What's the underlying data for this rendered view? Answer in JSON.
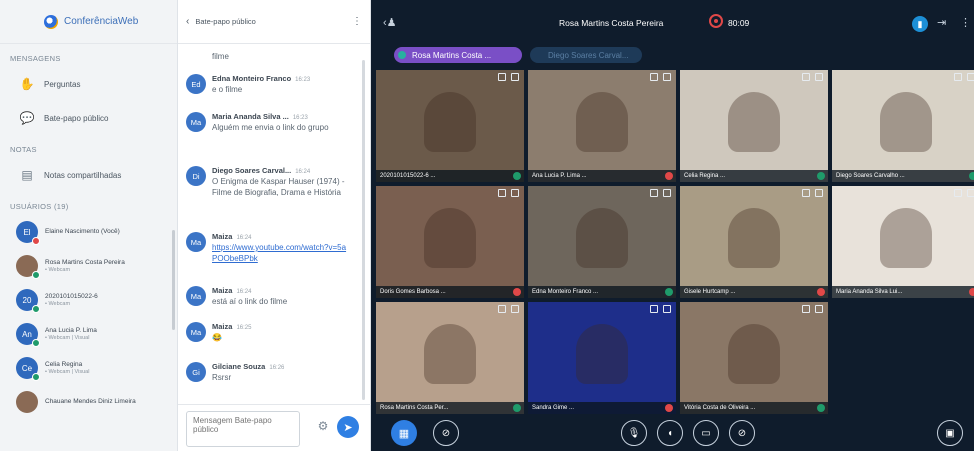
{
  "app": {
    "logo_text": "ConferênciaWeb"
  },
  "left": {
    "messages_section": "MENSAGENS",
    "items": [
      {
        "label": "Perguntas",
        "icon": "hand-icon"
      },
      {
        "label": "Bate-papo público",
        "icon": "chat-icon"
      }
    ],
    "notes_section": "NOTAS",
    "notes_item": {
      "label": "Notas compartilhadas",
      "icon": "notes-icon"
    },
    "users_section": "USUÁRIOS (19)",
    "users": [
      {
        "initials": "El",
        "name": "Elaine Nascimento (Você)",
        "sub": ""
      },
      {
        "initials": "",
        "name": "Rosa Martins Costa Pereira",
        "sub": "• Webcam"
      },
      {
        "initials": "20",
        "name": "2020101015022-6",
        "sub": "• Webcam"
      },
      {
        "initials": "An",
        "name": "Ana Lucia P. Lima",
        "sub": "• Webcam | Visual"
      },
      {
        "initials": "Ce",
        "name": "Celia Regina",
        "sub": "• Webcam | Visual"
      },
      {
        "initials": "",
        "name": "Chauane Mendes Diniz Limeira",
        "sub": ""
      }
    ]
  },
  "chat": {
    "title": "Bate-papo público",
    "messages": [
      {
        "initials": "",
        "name": "",
        "time": "",
        "text": "filme"
      },
      {
        "initials": "Ed",
        "name": "Edna Monteiro Franco",
        "time": "16:23",
        "text": "e o filme"
      },
      {
        "initials": "Ma",
        "name": "Maria Ananda Silva ...",
        "time": "16:23",
        "text": "Alguém me envia o link do grupo"
      },
      {
        "initials": "Di",
        "name": "Diego Soares Carval...",
        "time": "16:24",
        "text": "O Enigma de Kaspar Hauser (1974) - Filme de Biografia, Drama e História"
      },
      {
        "initials": "Ma",
        "name": "Maiza",
        "time": "16:24",
        "text": "https://www.youtube.com/watch?v=5aPOObeBPbk",
        "link": true
      },
      {
        "initials": "Ma",
        "name": "Maiza",
        "time": "16:24",
        "text": "está aí o link do filme"
      },
      {
        "initials": "Ma",
        "name": "Maiza",
        "time": "16:25",
        "text": "😂"
      },
      {
        "initials": "Gi",
        "name": "Gilciane Souza",
        "time": "16:26",
        "text": "Rsrsr"
      }
    ],
    "input_placeholder": "Mensagem Bate-papo público"
  },
  "video": {
    "presenter": "Rosa Martins Costa Pereira",
    "timer": "80:09",
    "pill_active": "Rosa Martins Costa ...",
    "pill_inactive": "Diego Soares Carval...",
    "tiles": [
      {
        "label": "2020101015022-6 ...",
        "mic": "on",
        "color": "#6b5a4a"
      },
      {
        "label": "Ana Lucia P. Lima ...",
        "mic": "off",
        "color": "#8c7d6e"
      },
      {
        "label": "Celia Regina ...",
        "mic": "on",
        "color": "#cfc8bd"
      },
      {
        "label": "Diego Soares Carvalho ...",
        "mic": "on",
        "color": "#d8d2c6"
      },
      {
        "label": "Doris Gomes Barbosa ...",
        "mic": "off",
        "color": "#7a5f50"
      },
      {
        "label": "Edna Monteiro Franco ...",
        "mic": "on",
        "color": "#6e665c"
      },
      {
        "label": "Gisele Hurtcamp ...",
        "mic": "off",
        "color": "#a99c85"
      },
      {
        "label": "Maria Ananda Silva Lui...",
        "mic": "off",
        "color": "#e8e2da"
      },
      {
        "label": "Rosa Martins Costa Per...",
        "mic": "on",
        "color": "#b7a08c"
      },
      {
        "label": "Sandra Gime ...",
        "mic": "off",
        "color": "#1e2e8a"
      },
      {
        "label": "Vitória Costa de Oliveira ...",
        "mic": "on",
        "color": "#8a7766"
      }
    ]
  }
}
